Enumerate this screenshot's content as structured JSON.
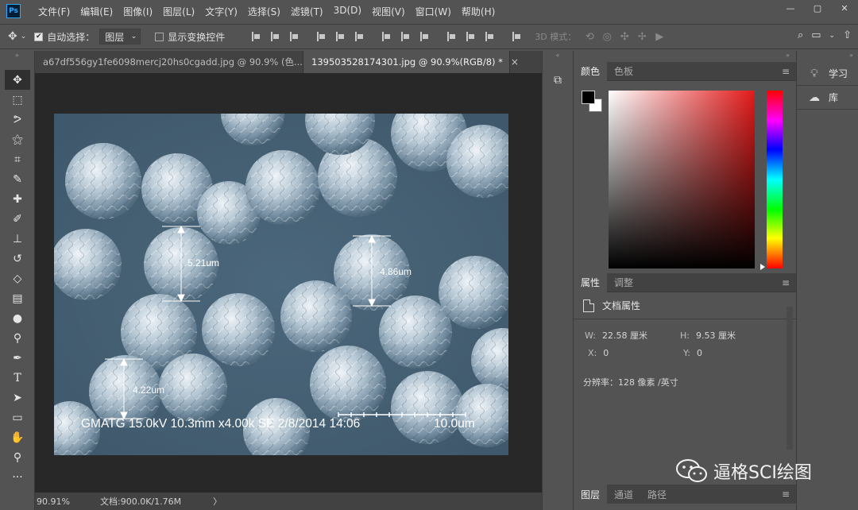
{
  "menubar": {
    "logo": "Ps",
    "items": [
      "文件(F)",
      "编辑(E)",
      "图像(I)",
      "图层(L)",
      "文字(Y)",
      "选择(S)",
      "滤镜(T)",
      "3D(D)",
      "视图(V)",
      "窗口(W)",
      "帮助(H)"
    ],
    "window_controls": [
      "—",
      "▢",
      "✕"
    ]
  },
  "options": {
    "auto_select_label": "自动选择：",
    "auto_select_value": "图层",
    "show_transform_label": "显示变换控件",
    "mode3d_label": "3D 模式："
  },
  "tabs": [
    {
      "label": "a67df556gy1fe6098mercj20hs0cgadd.jpg @ 90.9% (色...",
      "close": "×"
    },
    {
      "label": "139503528174301.jpg @ 90.9%(RGB/8) *",
      "close": "×"
    }
  ],
  "image": {
    "measurements": [
      "5.21um",
      "4.86um",
      "4.22um"
    ],
    "info_bar": "GMATG 15.0kV 10.3mm x4.00k SE  2/8/2014 14:06",
    "scale_label": "10.0um"
  },
  "status": {
    "zoom": "90.91%",
    "doc": "文档:900.0K/1.76M",
    "arrow": "〉"
  },
  "color_panel": {
    "tabs": [
      "颜色",
      "色板"
    ],
    "menu_icon": "≡"
  },
  "properties": {
    "tabs": [
      "属性",
      "调整"
    ],
    "title": "文档属性",
    "w_label": "W:",
    "w_value": "22.58 厘米",
    "h_label": "H:",
    "h_value": "9.53 厘米",
    "x_label": "X:",
    "x_value": "0",
    "y_label": "Y:",
    "y_value": "0",
    "resolution": "分辨率：128 像素 /英寸"
  },
  "layers_tabs": [
    "图层",
    "通道",
    "路径"
  ],
  "farright": [
    {
      "label": "学习",
      "icon": "lightbulb-icon"
    },
    {
      "label": "库",
      "icon": "library-icon"
    }
  ],
  "watermark": "逼格SCI绘图"
}
